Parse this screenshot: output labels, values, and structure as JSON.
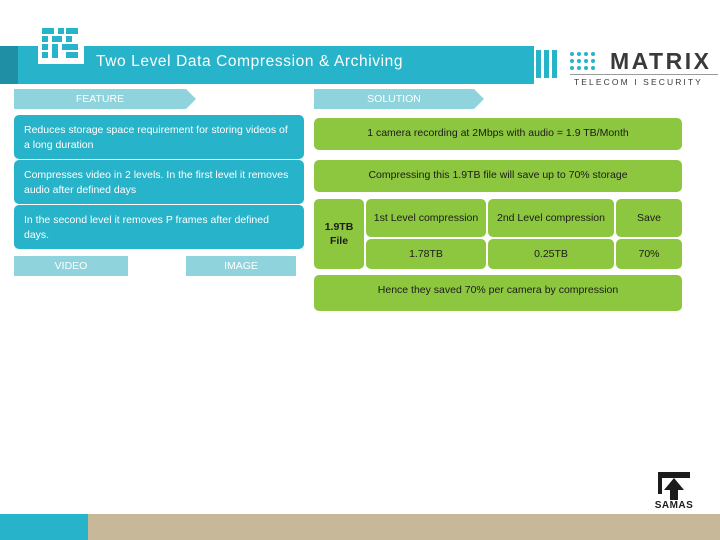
{
  "slide": {
    "title": "Two Level Data Compression & Archiving"
  },
  "brand": {
    "logo_icon": "matrix-square-logo-icon",
    "matrix_word": "MATRIX",
    "matrix_tagline": "TELECOM I SECURITY",
    "matrix_bars_icon": "three-vertical-bars-icon",
    "matrix_dots_icon": "dot-grid-icon"
  },
  "columns": {
    "feature_label": "FEATURE",
    "solution_label": "SOLUTION"
  },
  "features": [
    "Reduces storage space requirement for storing videos of a long duration",
    "Compresses video in 2 levels. In the first level it removes audio after defined days",
    "In the second level it removes P frames after defined days."
  ],
  "solutions": [
    "1 camera recording at 2Mbps with audio = 1.9 TB/Month",
    "Compressing this 1.9TB file will save up to 70% storage"
  ],
  "compression_table": {
    "file_label": "1.9TB File",
    "headers": [
      "1st Level compression",
      "2nd Level compression",
      "Save"
    ],
    "values": [
      "1.78TB",
      "0.25TB",
      "70%"
    ]
  },
  "conclusion": "Hence they saved 70% per camera by compression",
  "bottom_labels": {
    "video": "VIDEO",
    "image": "IMAGE"
  },
  "footer": {
    "samas_label": "SAMAS",
    "samas_icon": "upload-arrow-icon"
  },
  "colors": {
    "teal": "#27b3c9",
    "teal_light": "#8fd3dd",
    "green": "#8dc63f",
    "tan": "#c8b89a"
  }
}
